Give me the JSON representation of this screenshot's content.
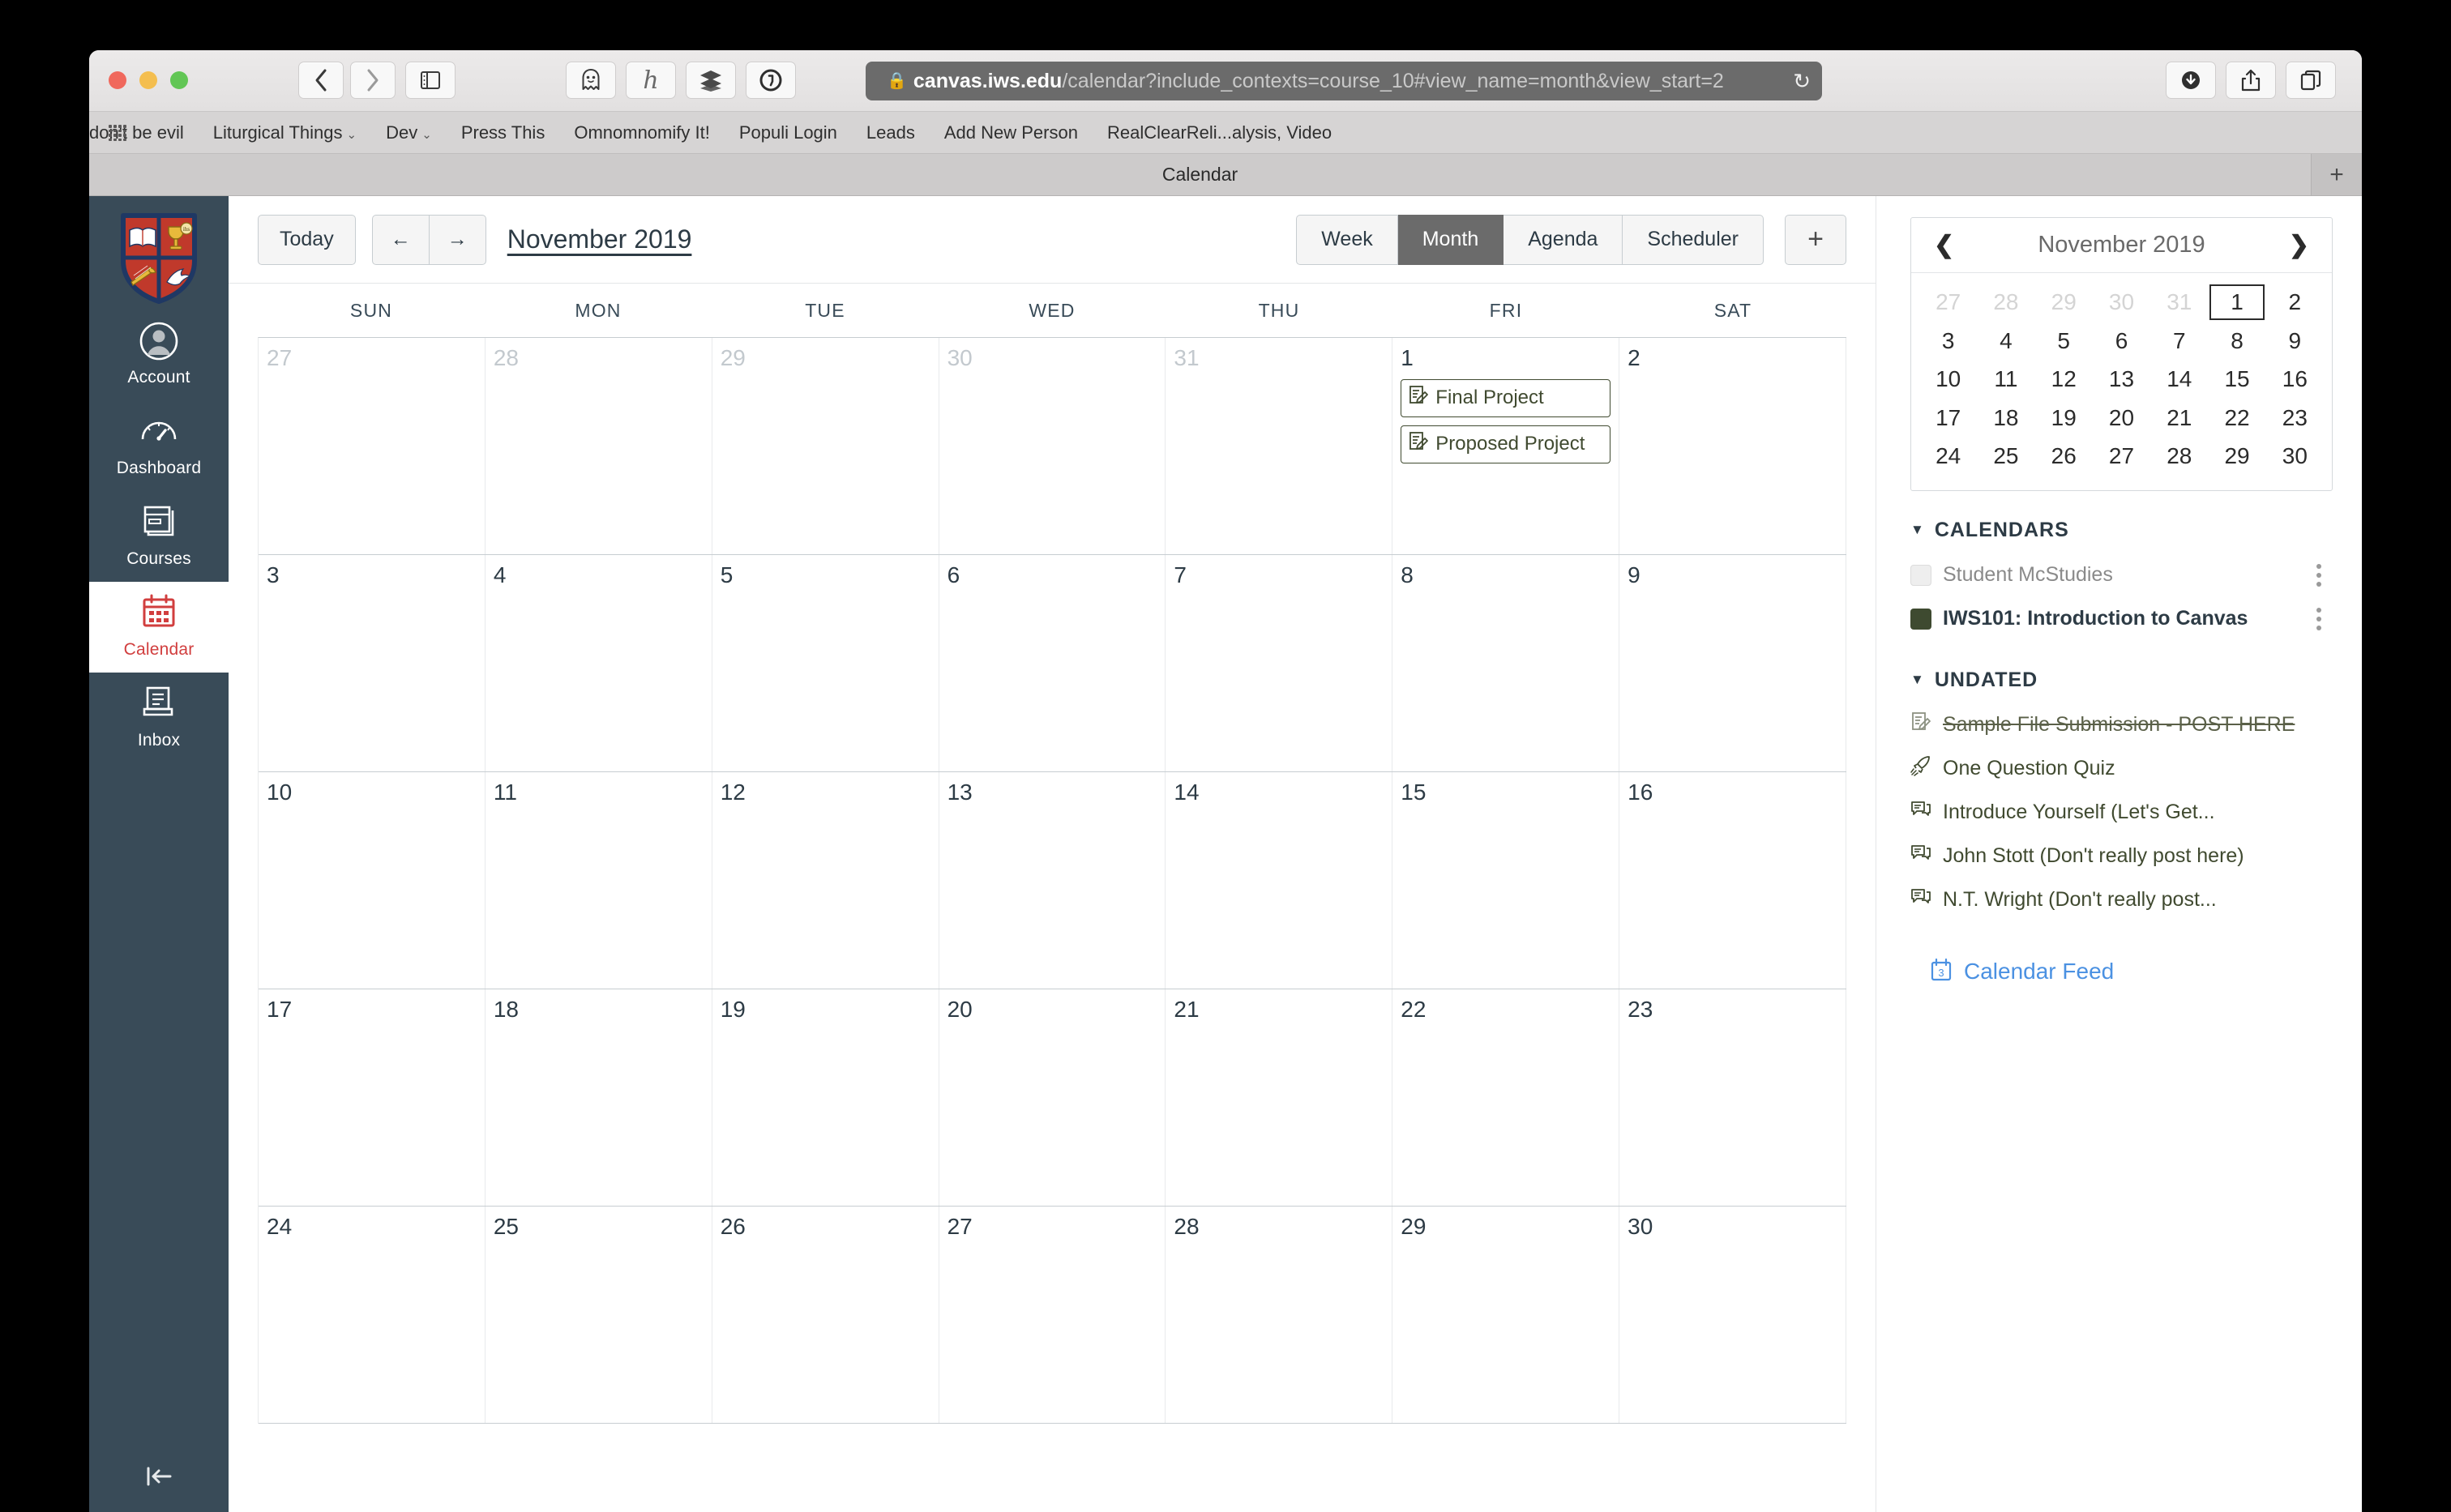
{
  "browser": {
    "traffic_lights": [
      "close",
      "minimize",
      "maximize"
    ],
    "nav": {
      "back": "‹",
      "forward": "›"
    },
    "sidebar_toggle_icon": "sidebar-icon",
    "extensions": [
      "ghostery-icon",
      "honey-icon",
      "buffer-icon",
      "onepassword-icon"
    ],
    "url": {
      "secure_host": "canvas.iws.edu",
      "path": "/calendar?include_contexts=course_10#view_name=month&view_start=2",
      "lock_icon": "lock-icon",
      "reload_icon": "reload-icon"
    },
    "right_buttons": [
      "downloads-icon",
      "share-icon",
      "tabs-icon"
    ],
    "bookmarks": [
      {
        "label": "don't be evil",
        "caret": false
      },
      {
        "label": "Liturgical Things",
        "caret": true
      },
      {
        "label": "Dev",
        "caret": true
      },
      {
        "label": "Press This",
        "caret": false
      },
      {
        "label": "Omnomnomify It!",
        "caret": false
      },
      {
        "label": "Populi Login",
        "caret": false
      },
      {
        "label": "Leads",
        "caret": false
      },
      {
        "label": "Add New Person",
        "caret": false
      },
      {
        "label": "RealClearReli...alysis, Video",
        "caret": false
      }
    ],
    "tabs": [
      {
        "title": "Calendar",
        "active": true
      }
    ],
    "new_tab_label": "+"
  },
  "sidebar": {
    "logo": "school-crest-logo",
    "items": [
      {
        "label": "Account",
        "icon": "account-avatar-icon",
        "active": false
      },
      {
        "label": "Dashboard",
        "icon": "dashboard-gauge-icon",
        "active": false
      },
      {
        "label": "Courses",
        "icon": "courses-book-icon",
        "active": false
      },
      {
        "label": "Calendar",
        "icon": "calendar-icon",
        "active": true
      },
      {
        "label": "Inbox",
        "icon": "inbox-icon",
        "active": false
      }
    ],
    "collapse_label": "collapse-nav-icon"
  },
  "toolbar": {
    "today_label": "Today",
    "prev_label": "←",
    "next_label": "→",
    "month_title": "November 2019",
    "views": [
      {
        "label": "Week",
        "selected": false
      },
      {
        "label": "Month",
        "selected": true
      },
      {
        "label": "Agenda",
        "selected": false
      },
      {
        "label": "Scheduler",
        "selected": false
      }
    ],
    "add_label": "+"
  },
  "calendar": {
    "day_headers": [
      "SUN",
      "MON",
      "TUE",
      "WED",
      "THU",
      "FRI",
      "SAT"
    ],
    "weeks": [
      [
        {
          "day": "27",
          "other": true,
          "events": []
        },
        {
          "day": "28",
          "other": true,
          "events": []
        },
        {
          "day": "29",
          "other": true,
          "events": []
        },
        {
          "day": "30",
          "other": true,
          "events": []
        },
        {
          "day": "31",
          "other": true,
          "events": []
        },
        {
          "day": "1",
          "other": false,
          "events": [
            {
              "title": "Final Project",
              "icon": "assignment-icon"
            },
            {
              "title": "Proposed Project",
              "icon": "assignment-icon"
            }
          ]
        },
        {
          "day": "2",
          "other": false,
          "events": []
        }
      ],
      [
        {
          "day": "3",
          "other": false,
          "events": []
        },
        {
          "day": "4",
          "other": false,
          "events": []
        },
        {
          "day": "5",
          "other": false,
          "events": []
        },
        {
          "day": "6",
          "other": false,
          "events": []
        },
        {
          "day": "7",
          "other": false,
          "events": []
        },
        {
          "day": "8",
          "other": false,
          "events": []
        },
        {
          "day": "9",
          "other": false,
          "events": []
        }
      ],
      [
        {
          "day": "10",
          "other": false,
          "events": []
        },
        {
          "day": "11",
          "other": false,
          "events": []
        },
        {
          "day": "12",
          "other": false,
          "events": []
        },
        {
          "day": "13",
          "other": false,
          "events": []
        },
        {
          "day": "14",
          "other": false,
          "events": []
        },
        {
          "day": "15",
          "other": false,
          "events": []
        },
        {
          "day": "16",
          "other": false,
          "events": []
        }
      ],
      [
        {
          "day": "17",
          "other": false,
          "events": []
        },
        {
          "day": "18",
          "other": false,
          "events": []
        },
        {
          "day": "19",
          "other": false,
          "events": []
        },
        {
          "day": "20",
          "other": false,
          "events": []
        },
        {
          "day": "21",
          "other": false,
          "events": []
        },
        {
          "day": "22",
          "other": false,
          "events": []
        },
        {
          "day": "23",
          "other": false,
          "events": []
        }
      ],
      [
        {
          "day": "24",
          "other": false,
          "events": []
        },
        {
          "day": "25",
          "other": false,
          "events": []
        },
        {
          "day": "26",
          "other": false,
          "events": []
        },
        {
          "day": "27",
          "other": false,
          "events": []
        },
        {
          "day": "28",
          "other": false,
          "events": []
        },
        {
          "day": "29",
          "other": false,
          "events": []
        },
        {
          "day": "30",
          "other": false,
          "events": []
        }
      ]
    ]
  },
  "minicalendar": {
    "title": "November 2019",
    "prev_icon": "chevron-left-icon",
    "next_icon": "chevron-right-icon",
    "days": [
      {
        "n": "27",
        "muted": true,
        "selected": false
      },
      {
        "n": "28",
        "muted": true,
        "selected": false
      },
      {
        "n": "29",
        "muted": true,
        "selected": false
      },
      {
        "n": "30",
        "muted": true,
        "selected": false
      },
      {
        "n": "31",
        "muted": true,
        "selected": false
      },
      {
        "n": "1",
        "muted": false,
        "selected": true
      },
      {
        "n": "2",
        "muted": false,
        "selected": false
      },
      {
        "n": "3",
        "muted": false,
        "selected": false
      },
      {
        "n": "4",
        "muted": false,
        "selected": false
      },
      {
        "n": "5",
        "muted": false,
        "selected": false
      },
      {
        "n": "6",
        "muted": false,
        "selected": false
      },
      {
        "n": "7",
        "muted": false,
        "selected": false
      },
      {
        "n": "8",
        "muted": false,
        "selected": false
      },
      {
        "n": "9",
        "muted": false,
        "selected": false
      },
      {
        "n": "10",
        "muted": false,
        "selected": false
      },
      {
        "n": "11",
        "muted": false,
        "selected": false
      },
      {
        "n": "12",
        "muted": false,
        "selected": false
      },
      {
        "n": "13",
        "muted": false,
        "selected": false
      },
      {
        "n": "14",
        "muted": false,
        "selected": false
      },
      {
        "n": "15",
        "muted": false,
        "selected": false
      },
      {
        "n": "16",
        "muted": false,
        "selected": false
      },
      {
        "n": "17",
        "muted": false,
        "selected": false
      },
      {
        "n": "18",
        "muted": false,
        "selected": false
      },
      {
        "n": "19",
        "muted": false,
        "selected": false
      },
      {
        "n": "20",
        "muted": false,
        "selected": false
      },
      {
        "n": "21",
        "muted": false,
        "selected": false
      },
      {
        "n": "22",
        "muted": false,
        "selected": false
      },
      {
        "n": "23",
        "muted": false,
        "selected": false
      },
      {
        "n": "24",
        "muted": false,
        "selected": false
      },
      {
        "n": "25",
        "muted": false,
        "selected": false
      },
      {
        "n": "26",
        "muted": false,
        "selected": false
      },
      {
        "n": "27",
        "muted": false,
        "selected": false
      },
      {
        "n": "28",
        "muted": false,
        "selected": false
      },
      {
        "n": "29",
        "muted": false,
        "selected": false
      },
      {
        "n": "30",
        "muted": false,
        "selected": false
      }
    ]
  },
  "calendars_section": {
    "heading": "CALENDARS",
    "items": [
      {
        "name": "Student McStudies",
        "checked": false,
        "color": "#eeeeee"
      },
      {
        "name": "IWS101: Introduction to Canvas",
        "checked": true,
        "color": "#3E4A30"
      }
    ]
  },
  "undated_section": {
    "heading": "UNDATED",
    "items": [
      {
        "title": "Sample File Submission - POST HERE",
        "icon": "assignment-icon",
        "struck": true
      },
      {
        "title": "One Question Quiz",
        "icon": "quiz-rocket-icon",
        "struck": false
      },
      {
        "title": "Introduce Yourself (Let's Get...",
        "icon": "discussion-icon",
        "struck": false
      },
      {
        "title": "John Stott (Don't really post here)",
        "icon": "discussion-icon",
        "struck": false
      },
      {
        "title": "N.T. Wright (Don't really post...",
        "icon": "discussion-icon",
        "struck": false
      }
    ]
  },
  "calendar_feed": {
    "label": "Calendar Feed",
    "icon": "calendar-feed-icon"
  },
  "colors": {
    "nav_bg": "#394B58",
    "active_accent": "#D13E3E",
    "course_color": "#3E4A30",
    "link_blue": "#4B91E2",
    "selected_view_bg": "#6B6B6B"
  }
}
